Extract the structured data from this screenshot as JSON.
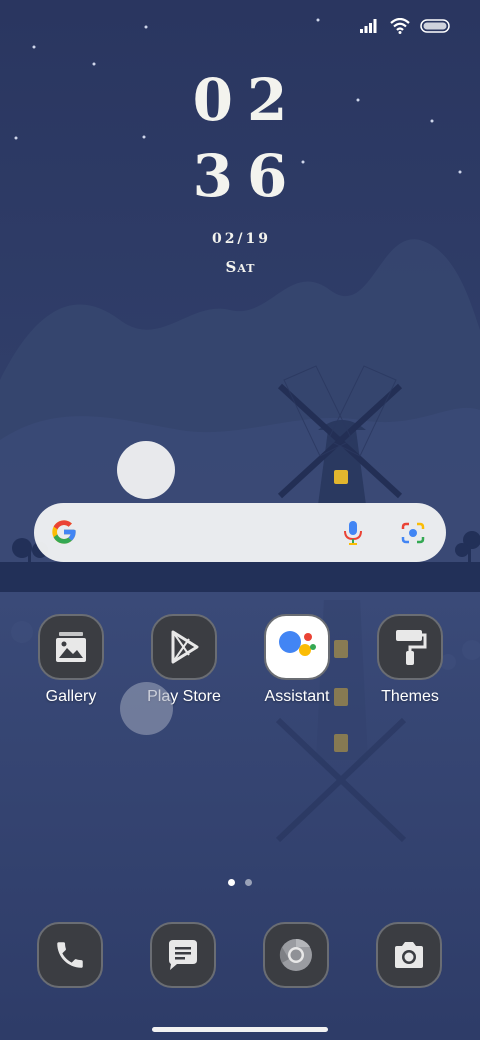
{
  "status_bar": {
    "signal_icon": "signal-bars-icon",
    "wifi_icon": "wifi-icon",
    "battery_icon": "battery-icon"
  },
  "lock_clock": {
    "hours": "02",
    "minutes": "36",
    "date": "02/19",
    "day": "Sat"
  },
  "search_bar": {
    "logo_icon": "google-g-icon",
    "voice_icon": "microphone-icon",
    "lens_icon": "google-lens-icon"
  },
  "apps": [
    {
      "label": "Gallery",
      "icon": "gallery-icon"
    },
    {
      "label": "Play Store",
      "icon": "play-store-icon"
    },
    {
      "label": "Assistant",
      "icon": "assistant-icon"
    },
    {
      "label": "Themes",
      "icon": "themes-roller-icon"
    }
  ],
  "dock": [
    {
      "icon": "phone-icon"
    },
    {
      "icon": "messages-icon"
    },
    {
      "icon": "chrome-icon"
    },
    {
      "icon": "camera-icon"
    }
  ],
  "page_indicator": {
    "pages": 2,
    "current": 1
  },
  "colors": {
    "sky": "#2c3a62",
    "icon_tile": "#3b3d42",
    "window_light": "#e2b62e",
    "google_blue": "#4285f4",
    "google_red": "#ea4335",
    "google_yellow": "#fbbc05",
    "google_green": "#34a853"
  }
}
